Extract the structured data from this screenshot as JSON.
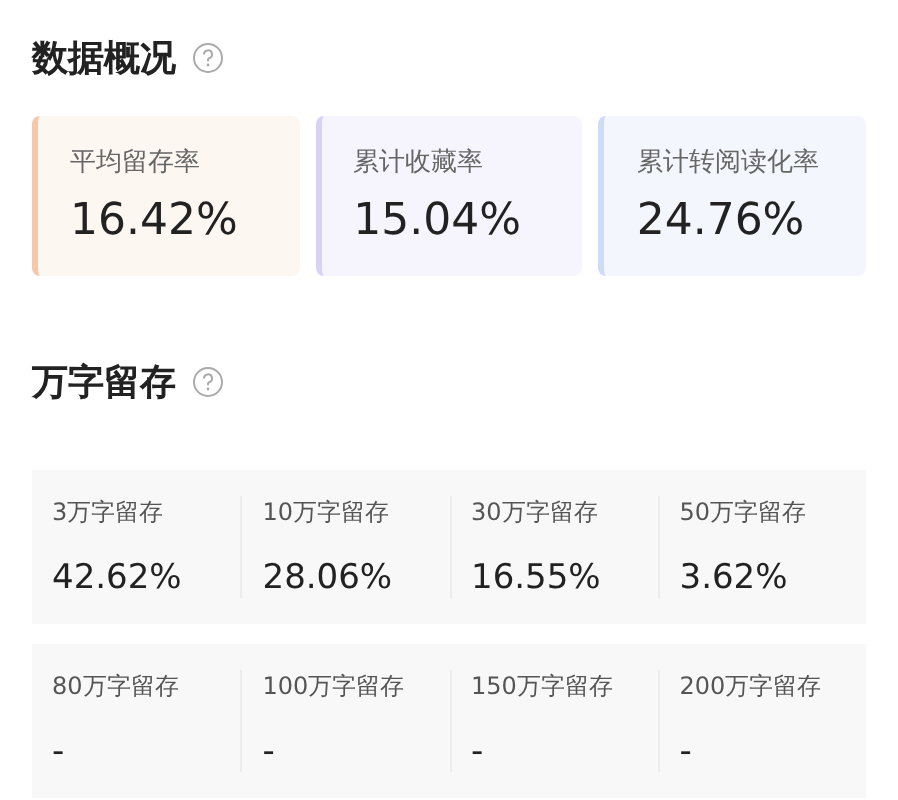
{
  "overview": {
    "title": "数据概况",
    "metrics": [
      {
        "label": "平均留存率",
        "value": "16.42%",
        "color": "#f3c9a8"
      },
      {
        "label": "累计收藏率",
        "value": "15.04%",
        "color": "#d9d2f3"
      },
      {
        "label": "累计转阅读化率",
        "value": "24.76%",
        "color": "#cfdcf5"
      }
    ]
  },
  "retention": {
    "title": "万字留存",
    "groups": [
      [
        {
          "label": "3万字留存",
          "value": "42.62%"
        },
        {
          "label": "10万字留存",
          "value": "28.06%"
        },
        {
          "label": "30万字留存",
          "value": "16.55%"
        },
        {
          "label": "50万字留存",
          "value": "3.62%"
        }
      ],
      [
        {
          "label": "80万字留存",
          "value": "-"
        },
        {
          "label": "100万字留存",
          "value": "-"
        },
        {
          "label": "150万字留存",
          "value": "-"
        },
        {
          "label": "200万字留存",
          "value": "-"
        }
      ]
    ]
  }
}
